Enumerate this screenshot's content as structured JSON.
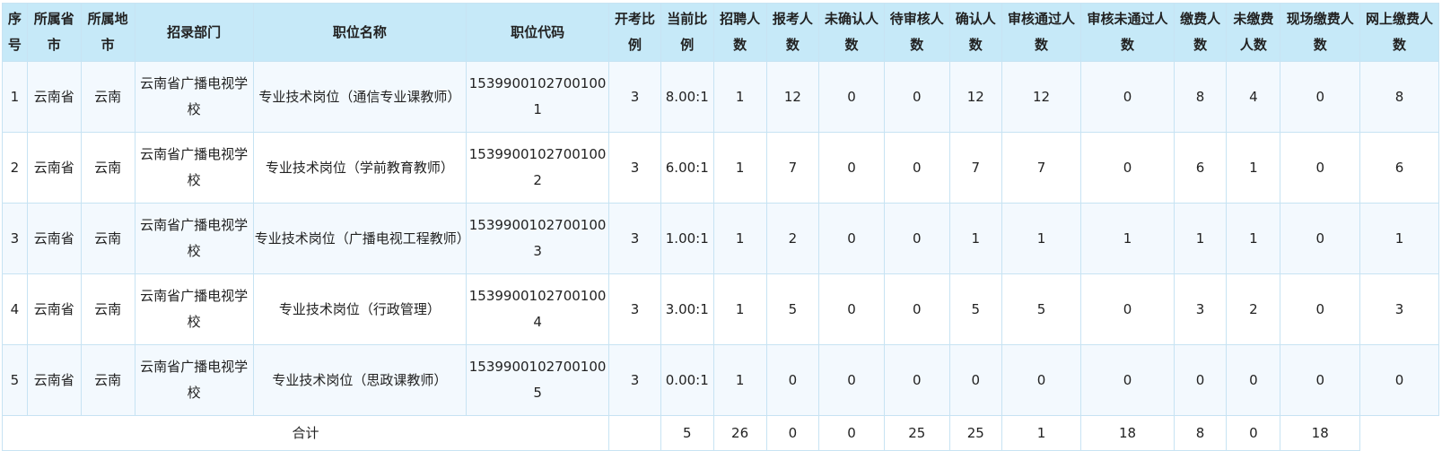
{
  "table": {
    "headers": [
      "序号",
      "所属省市",
      "所属地市",
      "招录部门",
      "职位名称",
      "职位代码",
      "开考比例",
      "当前比例",
      "招聘人数",
      "报考人数",
      "未确认人数",
      "待审核人数",
      "确认人数",
      "审核通过人数",
      "审核未通过人数",
      "缴费人数",
      "未缴费人数",
      "现场缴费人数",
      "网上缴费人数"
    ],
    "rows": [
      [
        "1",
        "云南省",
        "云南",
        "云南省广播电视学校",
        "专业技术岗位（通信专业课教师）",
        "15399001027001001",
        "3",
        "8.00:1",
        "1",
        "12",
        "0",
        "0",
        "12",
        "12",
        "0",
        "8",
        "4",
        "0",
        "8"
      ],
      [
        "2",
        "云南省",
        "云南",
        "云南省广播电视学校",
        "专业技术岗位（学前教育教师）",
        "15399001027001002",
        "3",
        "6.00:1",
        "1",
        "7",
        "0",
        "0",
        "7",
        "7",
        "0",
        "6",
        "1",
        "0",
        "6"
      ],
      [
        "3",
        "云南省",
        "云南",
        "云南省广播电视学校",
        "专业技术岗位（广播电视工程教师）",
        "15399001027001003",
        "3",
        "1.00:1",
        "1",
        "2",
        "0",
        "0",
        "1",
        "1",
        "1",
        "1",
        "1",
        "0",
        "1"
      ],
      [
        "4",
        "云南省",
        "云南",
        "云南省广播电视学校",
        "专业技术岗位（行政管理）",
        "15399001027001004",
        "3",
        "3.00:1",
        "1",
        "5",
        "0",
        "0",
        "5",
        "5",
        "0",
        "3",
        "2",
        "0",
        "3"
      ],
      [
        "5",
        "云南省",
        "云南",
        "云南省广播电视学校",
        "专业技术岗位（思政课教师）",
        "15399001027001005",
        "3",
        "0.00:1",
        "1",
        "0",
        "0",
        "0",
        "0",
        "0",
        "0",
        "0",
        "0",
        "0",
        "0"
      ]
    ],
    "total": {
      "label": "合计",
      "values": [
        "",
        "5",
        "26",
        "0",
        "0",
        "25",
        "25",
        "1",
        "18",
        "8",
        "0",
        "18"
      ]
    }
  }
}
